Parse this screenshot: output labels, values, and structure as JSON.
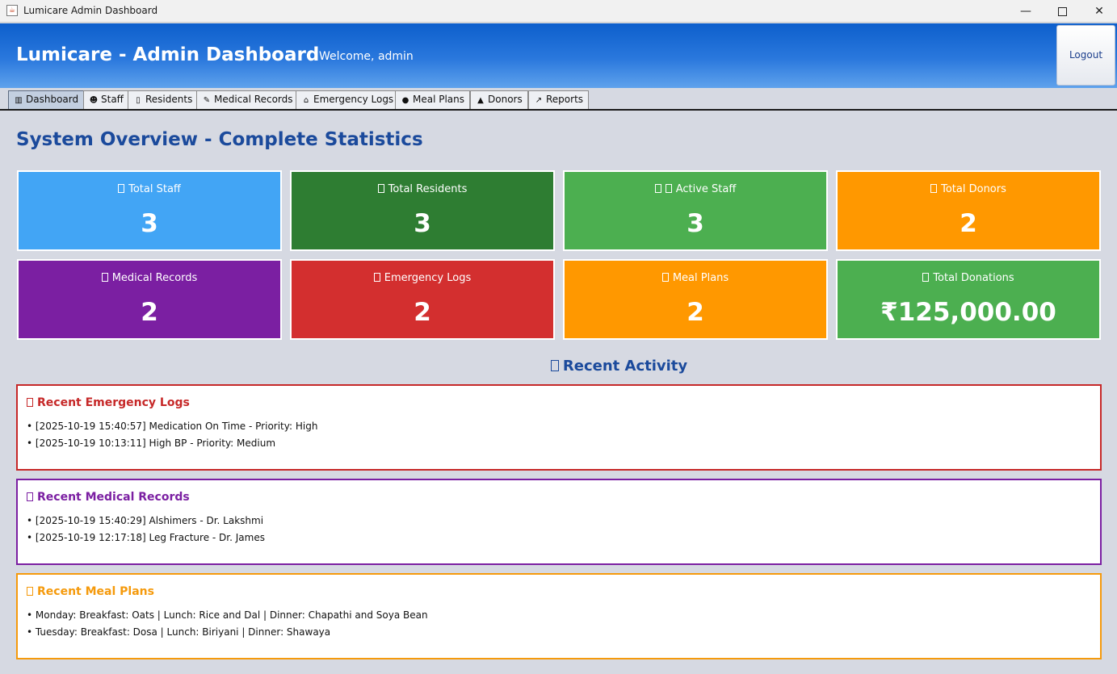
{
  "window": {
    "title": "Lumicare Admin Dashboard",
    "minimize": "—",
    "close": "✕"
  },
  "header": {
    "title": "Lumicare - Admin Dashboard",
    "welcome": "Welcome, admin",
    "logout_label": "Logout"
  },
  "tabs": [
    {
      "label": "Dashboard",
      "icon": "dashboard-icon",
      "icon_glyph": "▥",
      "active": true
    },
    {
      "label": "Staff",
      "icon": "staff-icon",
      "icon_glyph": "☻"
    },
    {
      "label": "Residents",
      "icon": "residents-icon",
      "icon_glyph": "▯"
    },
    {
      "label": "Medical Records",
      "icon": "pill-icon",
      "icon_glyph": "✎"
    },
    {
      "label": "Emergency Logs",
      "icon": "siren-icon",
      "icon_glyph": "⌂"
    },
    {
      "label": "Meal Plans",
      "icon": "food-icon",
      "icon_glyph": "●"
    },
    {
      "label": "Donors",
      "icon": "money-bag-icon",
      "icon_glyph": "▲"
    },
    {
      "label": "Reports",
      "icon": "chart-icon",
      "icon_glyph": "↗"
    }
  ],
  "overview_title": "System Overview - Complete Statistics",
  "stats": [
    {
      "label": "Total Staff",
      "value": "3",
      "color": "#42a5f5"
    },
    {
      "label": "Total Residents",
      "value": "3",
      "color": "#2e7d32"
    },
    {
      "label": "Active Staff",
      "value": "3",
      "color": "#4caf50"
    },
    {
      "label": "Total Donors",
      "value": "2",
      "color": "#ff9800"
    },
    {
      "label": "Medical Records",
      "value": "2",
      "color": "#7b1fa2"
    },
    {
      "label": "Emergency Logs",
      "value": "2",
      "color": "#d32f2f"
    },
    {
      "label": "Meal Plans",
      "value": "2",
      "color": "#ff9800"
    },
    {
      "label": "Total Donations",
      "value": "₹125,000.00",
      "color": "#4caf50"
    }
  ],
  "recent_activity_title": "Recent Activity",
  "panels": [
    {
      "title": "Recent Emergency Logs",
      "color": "#c62828",
      "items": [
        "• [2025-10-19 15:40:57] Medication On Time - Priority: High",
        "• [2025-10-19 10:13:11] High BP - Priority: Medium"
      ]
    },
    {
      "title": "Recent Medical Records",
      "color": "#7b1fa2",
      "items": [
        "• [2025-10-19 15:40:29] Alshimers - Dr. Lakshmi",
        "• [2025-10-19 12:17:18] Leg Fracture - Dr. James"
      ]
    },
    {
      "title": "Recent Meal Plans",
      "color": "#f59a0c",
      "items": [
        "• Monday: Breakfast: Oats | Lunch: Rice and Dal | Dinner: Chapathi and Soya Bean",
        "• Tuesday: Breakfast: Dosa | Lunch: Biriyani | Dinner: Shawaya"
      ]
    }
  ]
}
